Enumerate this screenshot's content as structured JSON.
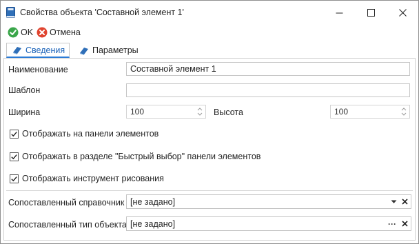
{
  "window": {
    "title": "Свойства объекта 'Составной элемент 1'"
  },
  "toolbar": {
    "ok_label": "OK",
    "cancel_label": "Отмена"
  },
  "tabs": [
    {
      "label": "Сведения",
      "active": true
    },
    {
      "label": "Параметры",
      "active": false
    }
  ],
  "form": {
    "name_label": "Наименование",
    "name_value": "Составной элемент 1",
    "template_label": "Шаблон",
    "template_value": "",
    "width_label": "Ширина",
    "width_value": "100",
    "height_label": "Высота",
    "height_value": "100"
  },
  "checkboxes": [
    {
      "label": "Отображать на панели элементов",
      "checked": true
    },
    {
      "label": "Отображать в разделе \"Быстрый выбор\" панели элементов",
      "checked": true
    },
    {
      "label": "Отображать инструмент рисования",
      "checked": true
    }
  ],
  "lookups": {
    "directory_label": "Сопоставленный справочник",
    "directory_value": "[не задано]",
    "object_type_label": "Сопоставленный тип объекта",
    "object_type_value": "[не задано]",
    "ellipsis": "···"
  },
  "colors": {
    "ok_green": "#3aa64a",
    "cancel_red": "#e0442f",
    "tab_accent": "#2b7bd6",
    "app_icon_blue": "#2f6fb8"
  }
}
